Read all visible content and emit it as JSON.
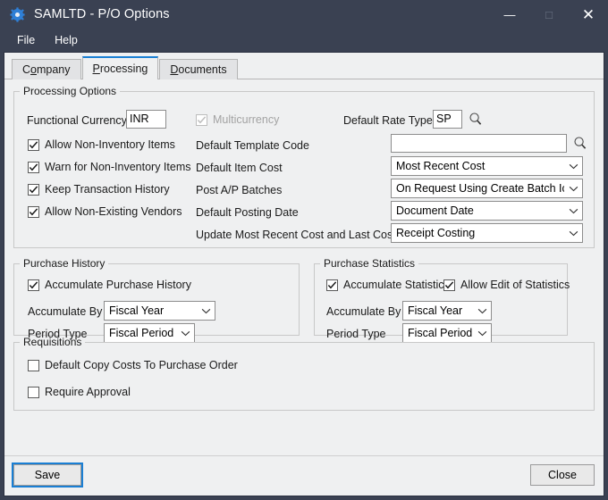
{
  "window": {
    "title": "SAMLTD - P/O Options",
    "icon": "gear-icon",
    "controls": {
      "minimize": "—",
      "maximize": "□",
      "close": "✕"
    }
  },
  "menu": {
    "items": [
      "File",
      "Help"
    ]
  },
  "tabs": [
    {
      "label": "Company",
      "mnemonic_index": 1,
      "active": false
    },
    {
      "label": "Processing",
      "mnemonic_index": 0,
      "active": true
    },
    {
      "label": "Documents",
      "mnemonic_index": 0,
      "active": false
    }
  ],
  "processing_options": {
    "legend": "Processing Options",
    "functional_currency": {
      "label": "Functional Currency",
      "value": "INR"
    },
    "multicurrency": {
      "label": "Multicurrency",
      "checked": true,
      "disabled": true
    },
    "default_rate_type": {
      "label": "Default Rate Type",
      "value": "SP",
      "finder": "magnifier-icon"
    },
    "checkboxes": [
      {
        "label": "Allow Non-Inventory Items",
        "checked": true
      },
      {
        "label": "Warn for Non-Inventory Items",
        "checked": true
      },
      {
        "label": "Keep Transaction History",
        "checked": true
      },
      {
        "label": "Allow Non-Existing Vendors",
        "checked": true
      }
    ],
    "fields": [
      {
        "label": "Default Template Code",
        "type": "textbox",
        "value": "",
        "finder": "magnifier-icon"
      },
      {
        "label": "Default Item Cost",
        "type": "combo",
        "value": "Most Recent Cost"
      },
      {
        "label": "Post A/P Batches",
        "type": "combo",
        "value": "On Request Using Create Batch Icon"
      },
      {
        "label": "Default Posting Date",
        "type": "combo",
        "value": "Document Date"
      },
      {
        "label": "Update Most Recent Cost and Last Cost At",
        "type": "combo",
        "value": "Receipt Costing"
      }
    ]
  },
  "purchase_history": {
    "legend": "Purchase History",
    "accumulate": {
      "label": "Accumulate Purchase History",
      "checked": true
    },
    "accumulate_by": {
      "label": "Accumulate By",
      "value": "Fiscal Year"
    },
    "period_type": {
      "label": "Period Type",
      "value": "Fiscal Period"
    }
  },
  "purchase_statistics": {
    "legend": "Purchase Statistics",
    "accumulate": {
      "label": "Accumulate Statistics",
      "checked": true
    },
    "allow_edit": {
      "label": "Allow Edit of Statistics",
      "checked": true
    },
    "accumulate_by": {
      "label": "Accumulate By",
      "value": "Fiscal Year"
    },
    "period_type": {
      "label": "Period Type",
      "value": "Fiscal Period"
    }
  },
  "requisitions": {
    "legend": "Requisitions",
    "checkboxes": [
      {
        "label": "Default Copy Costs To Purchase Order",
        "checked": false
      },
      {
        "label": "Require Approval",
        "checked": false
      }
    ]
  },
  "footer": {
    "save_label": "Save",
    "close_label": "Close"
  },
  "colors": {
    "titlebar": "#3a4152",
    "accent": "#1a7fd4",
    "client_bg": "#eff0f1",
    "group_border": "#c8c8c8"
  }
}
